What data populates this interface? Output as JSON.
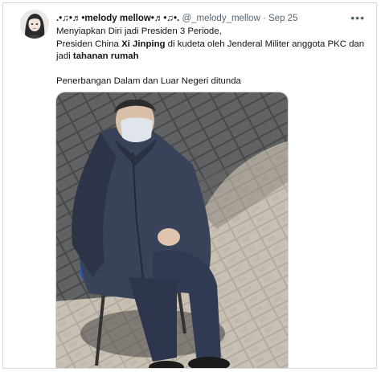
{
  "tweet": {
    "display_name": ".•♫•♬•melody mellow•♬•♫•.",
    "handle": "@_melody_mellow",
    "separator": "·",
    "date": "Sep 25",
    "more_glyph": "•••",
    "lines": {
      "l1": "Menyiapkan Diri jadi Presiden 3 Periode,",
      "l2_a": "Presiden China ",
      "l2_b": "Xi Jinping",
      "l2_c": " di kudeta oleh Jenderal Militer anggota PKC dan",
      "l3_a": "jadi ",
      "l3_b": "tahanan rumah",
      "l4": "Penerbangan Dalam dan Luar Negeri ditunda"
    }
  },
  "icons": {
    "avatar": "avatar-illustration",
    "more": "more-options-icon"
  },
  "colors": {
    "text": "#0f1419",
    "secondary": "#536471",
    "border": "#cfd9de"
  }
}
